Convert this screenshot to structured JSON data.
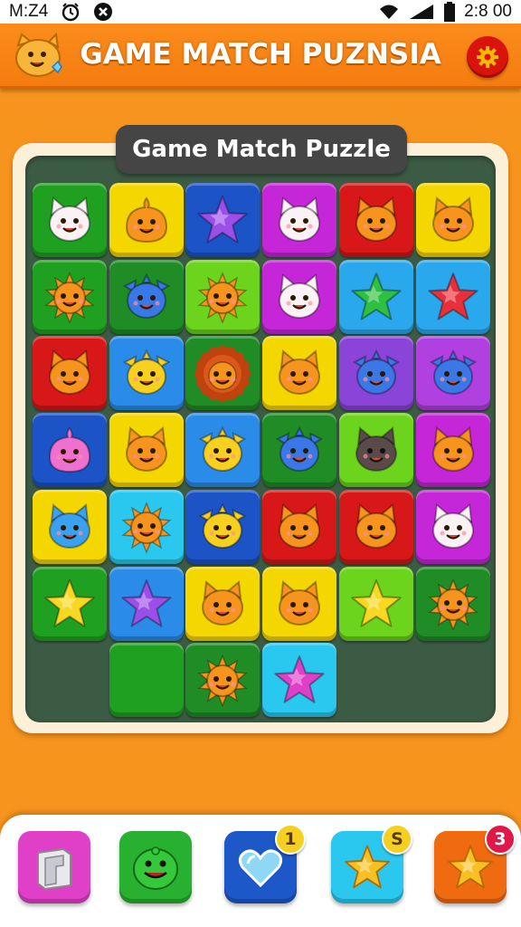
{
  "status_bar": {
    "left_text": "M:Z4",
    "time": "2:8 00",
    "icons": [
      "alarm-icon",
      "close-circle-icon",
      "wifi-icon",
      "signal-icon",
      "battery-icon"
    ]
  },
  "header": {
    "title": "GAME MATCH PUZNSIA",
    "logo_icon": "cat-face-icon",
    "settings_icon": "gear-icon"
  },
  "board": {
    "title": "Game Match Puzzle",
    "rows": [
      [
        {
          "color": "#20a020",
          "piece": "cat-white"
        },
        {
          "color": "#f5d700",
          "piece": "blob-orange"
        },
        {
          "color": "#1c54c8",
          "piece": "star-purple"
        },
        {
          "color": "#c426d8",
          "piece": "cat-white"
        },
        {
          "color": "#d81818",
          "piece": "cat-orange"
        },
        {
          "color": "#f5d700",
          "piece": "cat-orange"
        }
      ],
      [
        {
          "color": "#20a020",
          "piece": "sun-orange"
        },
        {
          "color": "#1f8c26",
          "piece": "fish-blue"
        },
        {
          "color": "#6cd41c",
          "piece": "sun-orange"
        },
        {
          "color": "#c426d8",
          "piece": "cat-white"
        },
        {
          "color": "#2aa8ee",
          "piece": "star-green"
        },
        {
          "color": "#2aa8ee",
          "piece": "star-red"
        }
      ],
      [
        {
          "color": "#d81818",
          "piece": "cat-orange"
        },
        {
          "color": "#2a8ce8",
          "piece": "fish-yellow"
        },
        {
          "color": "#1f8c26",
          "piece": "lion-orange"
        },
        {
          "color": "#f5d700",
          "piece": "cat-orange"
        },
        {
          "color": "#8a44d8",
          "piece": "fish-blue"
        },
        {
          "color": "#b040e0",
          "piece": "fish-blue"
        }
      ],
      [
        {
          "color": "#1c54c8",
          "piece": "blob-pink"
        },
        {
          "color": "#f5d700",
          "piece": "cat-orange"
        },
        {
          "color": "#2a8ce8",
          "piece": "fish-yellow"
        },
        {
          "color": "#1f8c26",
          "piece": "fish-blue"
        },
        {
          "color": "#6cd41c",
          "piece": "cat-dark"
        },
        {
          "color": "#c426d8",
          "piece": "cat-orange"
        }
      ],
      [
        {
          "color": "#f5d700",
          "piece": "cat-blue"
        },
        {
          "color": "#2ac8ee",
          "piece": "sun-orange"
        },
        {
          "color": "#1c54c8",
          "piece": "fish-yellow"
        },
        {
          "color": "#d81818",
          "piece": "cat-orange"
        },
        {
          "color": "#d81818",
          "piece": "cat-orange"
        },
        {
          "color": "#c426d8",
          "piece": "cat-white"
        }
      ],
      [
        {
          "color": "#20a020",
          "piece": "star-yellow"
        },
        {
          "color": "#2a8ce8",
          "piece": "star-purple"
        },
        {
          "color": "#f5d700",
          "piece": "cat-orange"
        },
        {
          "color": "#f5d700",
          "piece": "cat-orange"
        },
        {
          "color": "#6cd41c",
          "piece": "star-yellow"
        },
        {
          "color": "#1f8c26",
          "piece": "sun-orange"
        }
      ],
      [
        null,
        {
          "color": "#20a020",
          "piece": "empty"
        },
        {
          "color": "#1f8c26",
          "piece": "sun-orange"
        },
        {
          "color": "#2ac8ee",
          "piece": "star-pink"
        },
        null,
        null
      ]
    ]
  },
  "bottom_bar": {
    "buttons": [
      {
        "name": "map-booster-button",
        "icon": "map-icon",
        "color": "#e040c8",
        "badge": ""
      },
      {
        "name": "frog-booster-button",
        "icon": "frog-face-icon",
        "color": "#28b030",
        "badge": ""
      },
      {
        "name": "heart-booster-button",
        "icon": "heart-icon",
        "color": "#1c58c8",
        "badge": "1",
        "badge_color": "#f5d020"
      },
      {
        "name": "star-booster-button",
        "icon": "star-icon",
        "color": "#2ac8ee",
        "badge": "S",
        "badge_color": "#f5d020"
      },
      {
        "name": "super-star-booster-button",
        "icon": "star-icon",
        "color": "#f06a10",
        "badge": "3",
        "badge_color": "#e01848"
      }
    ]
  }
}
